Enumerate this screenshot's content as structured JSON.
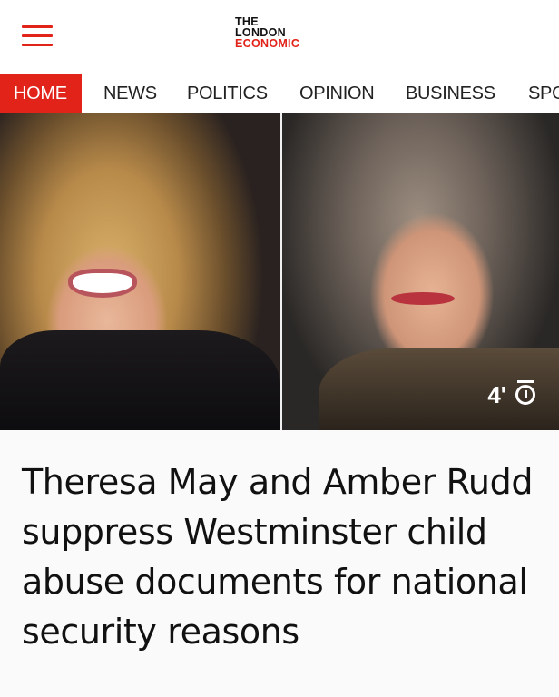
{
  "header": {
    "logo": {
      "line1": "THE",
      "line2": "LONDON",
      "line3": "ECONOMIC"
    },
    "menu_icon": "hamburger-menu-icon"
  },
  "nav": {
    "items": [
      {
        "label": "HOME",
        "active": true
      },
      {
        "label": "NEWS",
        "active": false
      },
      {
        "label": "POLITICS",
        "active": false
      },
      {
        "label": "OPINION",
        "active": false
      },
      {
        "label": "BUSINESS",
        "active": false
      },
      {
        "label": "SPO",
        "active": false
      }
    ]
  },
  "hero": {
    "duration_text": "4'",
    "duration_icon": "stopwatch-icon"
  },
  "article": {
    "headline": "Theresa May and Amber Rudd suppress Westminster child abuse documents for national security reasons"
  },
  "colors": {
    "accent": "#e2231a",
    "text": "#111111"
  }
}
